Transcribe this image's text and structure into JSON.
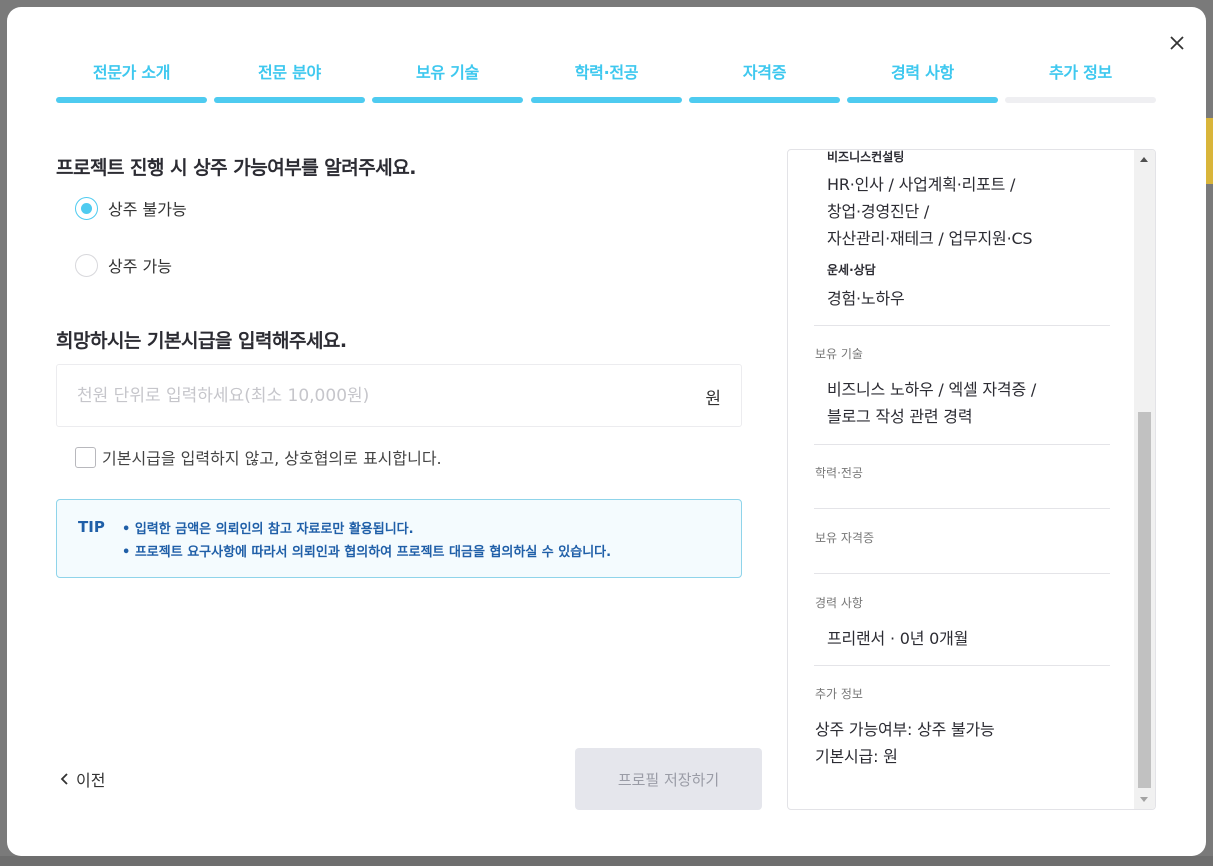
{
  "steps": [
    {
      "label": "전문가 소개",
      "active": true
    },
    {
      "label": "전문 분야",
      "active": true
    },
    {
      "label": "보유 기술",
      "active": true
    },
    {
      "label": "학력·전공",
      "active": true
    },
    {
      "label": "자격증",
      "active": true
    },
    {
      "label": "경력 사항",
      "active": true
    },
    {
      "label": "추가 정보",
      "active": false
    }
  ],
  "form": {
    "resident_question": "프로젝트 진행 시 상주 가능여부를 알려주세요.",
    "options": [
      "상주 불가능",
      "상주 가능"
    ],
    "selected_option": "상주 불가능",
    "wage_question": "희망하시는 기본시급을 입력해주세요.",
    "wage_placeholder": "천원 단위로 입력하세요(최소 10,000원)",
    "wage_value": "",
    "wage_unit": "원",
    "negotiable_label": "기본시급을 입력하지 않고, 상호협의로 표시합니다.",
    "tip_tag": "TIP",
    "tip_line1": "• 입력한 금액은 의뢰인의 참고 자료로만 활용됩니다.",
    "tip_line2": "• 프로젝트 요구사항에 따라서 의뢰인과 협의하여 프로젝트 대금을 협의하실 수 있습니다.",
    "prev_label": "이전",
    "save_label": "프로필 저장하기"
  },
  "preview": {
    "cat1_title": "비즈니스컨설팅",
    "cat1_line1": "HR·인사  / 사업계획·리포트  /",
    "cat1_line2": "창업·경영진단  /",
    "cat1_line3": "자산관리·재테크  / 업무지원·CS",
    "cat2_title": "운세·상담",
    "cat2_line1": "경험·노하우",
    "skills_title": "보유 기술",
    "skills_line1": "비즈니스 노하우 / 엑셀 자격증 /",
    "skills_line2": "블로그 작성 관련 경력",
    "edu_title": "학력·전공",
    "cert_title": "보유 자격증",
    "career_title": "경력 사항",
    "career_line1": "프리랜서 · 0년 0개월",
    "extra_title": "추가 정보",
    "extra_line1": "상주 가능여부: 상주 불가능",
    "extra_line2": "기본시급: 원"
  },
  "colors": {
    "accent": "#4ecbf0",
    "tip_text": "#1f5fa8",
    "disabled_button": "#e5e6ec"
  }
}
